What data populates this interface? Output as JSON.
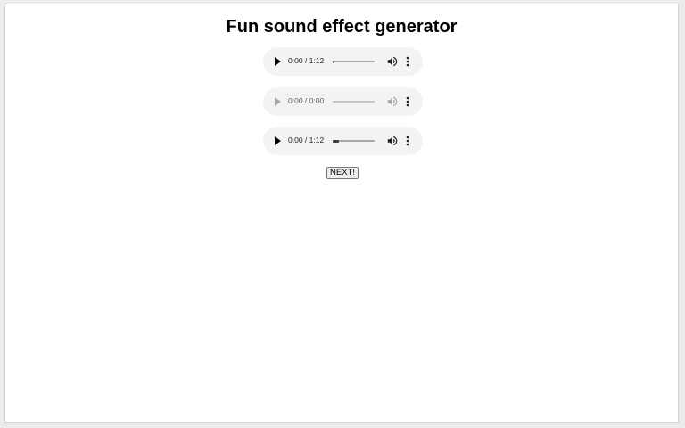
{
  "page": {
    "title": "Fun sound effect generator"
  },
  "players": [
    {
      "time": "0:00 / 1:12",
      "progress": 0.02,
      "enabled": true
    },
    {
      "time": "0:00 / 0:00",
      "progress": 0,
      "enabled": false
    },
    {
      "time": "0:00 / 1:12",
      "progress": 0.15,
      "enabled": true
    }
  ],
  "icons": {
    "play": "play-icon",
    "volume": "volume-icon",
    "more": "more-options-icon"
  },
  "next_button": {
    "label": "NEXT!"
  },
  "colors": {
    "player_bg": "#f1f3f4",
    "text": "#000000",
    "disabled": "#a6a6a6"
  }
}
